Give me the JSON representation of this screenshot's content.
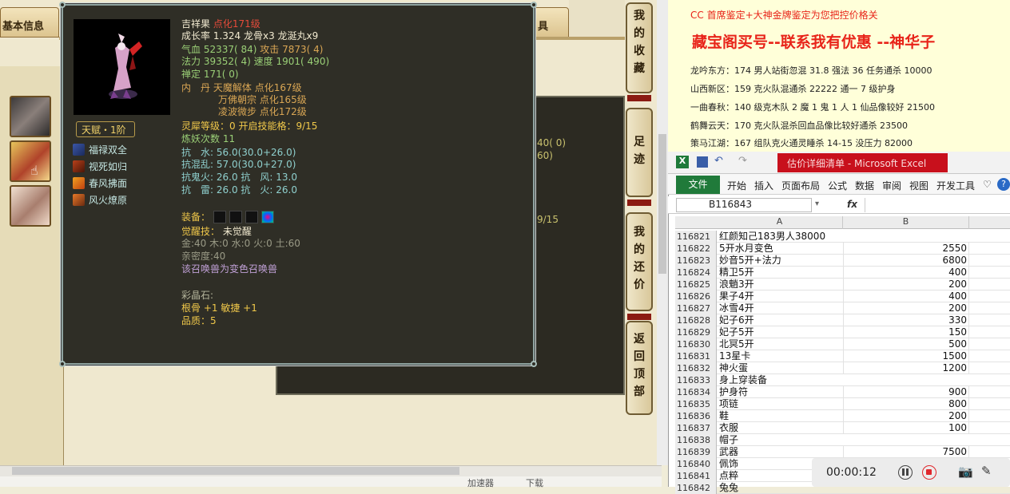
{
  "game": {
    "tab_basic": "基本信息",
    "tab_right": "具",
    "status_items": [
      "加速器",
      "下载"
    ]
  },
  "side_buttons": [
    {
      "label": "我的收藏",
      "chars": [
        "我",
        "的",
        "收",
        "藏"
      ]
    },
    {
      "label": "足迹",
      "chars": [
        "足",
        "迹"
      ]
    },
    {
      "label": "我的还价",
      "chars": [
        "我",
        "的",
        "还",
        "价"
      ]
    },
    {
      "label": "返回顶部",
      "chars": [
        "返",
        "回",
        "顶",
        "部"
      ]
    }
  ],
  "tooltip": {
    "name": "吉祥果",
    "name_level": "点化171级",
    "growth": "成长率 1.324 龙骨x3 龙涎丸x9",
    "hp_label": "气血",
    "hp": "52337( 84)",
    "atk_label": "攻击",
    "atk": "7873( 4)",
    "mp_label": "法力",
    "mp": "39352( 4)",
    "spd_label": "速度",
    "spd": "1901( 490)",
    "shen_label": "禅定",
    "shen": "171( 0)",
    "neidan_label": "内　丹",
    "neidan": [
      {
        "name": "天魔解体",
        "level": "点化167级"
      },
      {
        "name": "万佛朝宗",
        "level": "点化165级"
      },
      {
        "name": "凌波微步",
        "level": "点化172级"
      }
    ],
    "tier_badge": "天赋・1阶",
    "skills": [
      "福禄双全",
      "视死如归",
      "春风拂面",
      "风火燎原"
    ],
    "rank": "灵犀等级：0 开启技能格：9/15",
    "refine": "炼妖次数 11",
    "resist": [
      "抗　水: 56.0(30.0+26.0)",
      "抗混乱: 57.0(30.0+27.0)",
      "抗鬼火: 26.0 抗　风: 13.0",
      "抗　雷: 26.0 抗　火: 26.0"
    ],
    "equip_label": "装备：",
    "awaken_label": "觉醒技：",
    "awaken_value": "未觉醒",
    "elements": "金:40 木:0 水:0 火:0 土:60",
    "intimacy": "亲密度:40",
    "summon_note": "该召唤兽为变色召唤兽",
    "crystal_label": "彩晶石:",
    "crystal_value": "根骨 +1 敏捷 +1",
    "quality": "品质：5"
  },
  "background_panel": {
    "partial_a": "40( 0)",
    "partial_b": "60)",
    "partial_c": "9/15"
  },
  "promo": {
    "subtitle": "CC 首席鉴定+大神金牌鉴定为您把控价格关",
    "title": "藏宝阁买号--联系我有优惠 --神华子",
    "lines": [
      "龙吟东方：174 男人站街忽混 31.8 强法 36 任务通杀 10000",
      "山西新区：159 克火队混通杀 22222 通一 7 级护身",
      "一曲春秋：140 级克木队 2 魔 1 鬼 1 人 1 仙品像较好 21500",
      "鹤舞云天：170 克火队混杀回血品像比较好通杀 23500",
      "策马江湖：167 组队克火通灵睡杀 14-15 没压力 82000"
    ]
  },
  "excel": {
    "title": "估价详细清单 - Microsoft Excel",
    "ribbon": [
      "文件",
      "开始",
      "插入",
      "页面布局",
      "公式",
      "数据",
      "审阅",
      "视图",
      "开发工具"
    ],
    "name_box": "B116843",
    "fx": "fx",
    "col_a": "A",
    "col_b": "B",
    "rows": [
      {
        "n": "116821",
        "a": "红颜知己183男人38000",
        "b": ""
      },
      {
        "n": "116822",
        "a": "5开水月变色",
        "b": "2550"
      },
      {
        "n": "116823",
        "a": "妙音5开+法力",
        "b": "6800"
      },
      {
        "n": "116824",
        "a": "精卫5开",
        "b": "400"
      },
      {
        "n": "116825",
        "a": "浪魈3开",
        "b": "200"
      },
      {
        "n": "116826",
        "a": "果子4开",
        "b": "400"
      },
      {
        "n": "116827",
        "a": "冰雪4开",
        "b": "200"
      },
      {
        "n": "116828",
        "a": "妃子6开",
        "b": "330"
      },
      {
        "n": "116829",
        "a": "妃子5开",
        "b": "150"
      },
      {
        "n": "116830",
        "a": "北冥5开",
        "b": "500"
      },
      {
        "n": "116831",
        "a": "13星卡",
        "b": "1500"
      },
      {
        "n": "116832",
        "a": "神火蛋",
        "b": "1200"
      },
      {
        "n": "116833",
        "a": "身上穿装备",
        "b": ""
      },
      {
        "n": "116834",
        "a": "护身符",
        "b": "900"
      },
      {
        "n": "116835",
        "a": "项链",
        "b": "800"
      },
      {
        "n": "116836",
        "a": "鞋",
        "b": "200"
      },
      {
        "n": "116837",
        "a": "衣服",
        "b": "100"
      },
      {
        "n": "116838",
        "a": "帽子",
        "b": ""
      },
      {
        "n": "116839",
        "a": "武器",
        "b": "7500"
      },
      {
        "n": "116840",
        "a": "佩饰",
        "b": ""
      },
      {
        "n": "116841",
        "a": "点粹",
        "b": ""
      },
      {
        "n": "116842",
        "a": "兔兔",
        "b": ""
      }
    ]
  },
  "recorder": {
    "time": "00:00:12"
  }
}
